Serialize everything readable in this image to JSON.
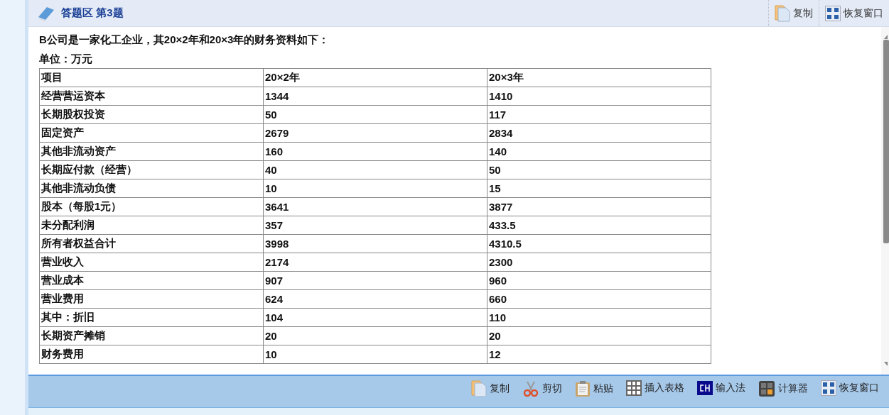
{
  "header": {
    "title": "答题区 第3题",
    "buttons": [
      {
        "kind": "copy",
        "label": "复制"
      },
      {
        "kind": "restore",
        "label": "恢复窗口"
      }
    ]
  },
  "question": {
    "intro": "B公司是一家化工企业，其20×2年和20×3年的财务资料如下：",
    "unit": "单位：万元"
  },
  "table": {
    "columns": [
      "项目",
      "20×2年",
      "20×3年"
    ],
    "rows": [
      [
        "经营营运资本",
        "1344",
        "1410"
      ],
      [
        "长期股权投资",
        "50",
        "117"
      ],
      [
        "固定资产",
        "2679",
        "2834"
      ],
      [
        "其他非流动资产",
        "160",
        "140"
      ],
      [
        "长期应付款（经营）",
        "40",
        "50"
      ],
      [
        "其他非流动负债",
        "10",
        "15"
      ],
      [
        "股本（每股1元）",
        "3641",
        "3877"
      ],
      [
        "未分配利润",
        "357",
        "433.5"
      ],
      [
        "所有者权益合计",
        "3998",
        "4310.5"
      ],
      [
        "营业收入",
        "2174",
        "2300"
      ],
      [
        "营业成本",
        "907",
        "960"
      ],
      [
        "营业费用",
        "624",
        "660"
      ],
      [
        "其中：折旧",
        "104",
        "110"
      ],
      [
        "长期资产摊销",
        "20",
        "20"
      ],
      [
        "财务费用",
        "10",
        "12"
      ]
    ]
  },
  "toolbar": [
    {
      "kind": "copy",
      "label": "复制"
    },
    {
      "kind": "cut",
      "label": "剪切"
    },
    {
      "kind": "paste",
      "label": "粘贴"
    },
    {
      "kind": "table",
      "label": "插入表格"
    },
    {
      "kind": "ime",
      "label": "输入法"
    },
    {
      "kind": "calculator",
      "label": "计算器"
    },
    {
      "kind": "restore",
      "label": "恢复窗口"
    }
  ]
}
